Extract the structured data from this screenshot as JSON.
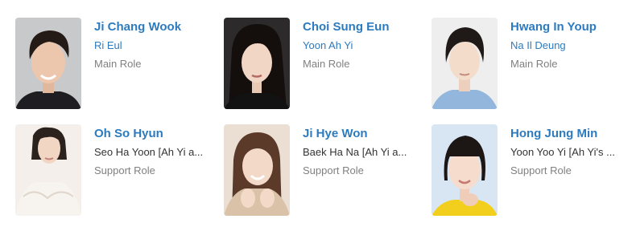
{
  "cast": [
    {
      "name": "Ji Chang Wook",
      "character": "Ri Eul",
      "role": "Main Role",
      "character_link": true
    },
    {
      "name": "Choi Sung Eun",
      "character": "Yoon Ah Yi",
      "role": "Main Role",
      "character_link": true
    },
    {
      "name": "Hwang In Youp",
      "character": "Na Il Deung",
      "role": "Main Role",
      "character_link": true
    },
    {
      "name": "Oh So Hyun",
      "character": "Seo Ha Yoon [Ah Yi a...",
      "role": "Support Role",
      "character_link": false
    },
    {
      "name": "Ji Hye Won",
      "character": "Baek Ha Na [Ah Yi a...",
      "role": "Support Role",
      "character_link": false
    },
    {
      "name": "Hong Jung Min",
      "character": "Yoon Yoo Yi [Ah Yi's ...",
      "role": "Support Role",
      "character_link": false
    }
  ],
  "colors": {
    "name_link": "#2d7bbf",
    "character_link": "#2d7bbf",
    "character_text": "#333333",
    "role_text": "#808080"
  }
}
